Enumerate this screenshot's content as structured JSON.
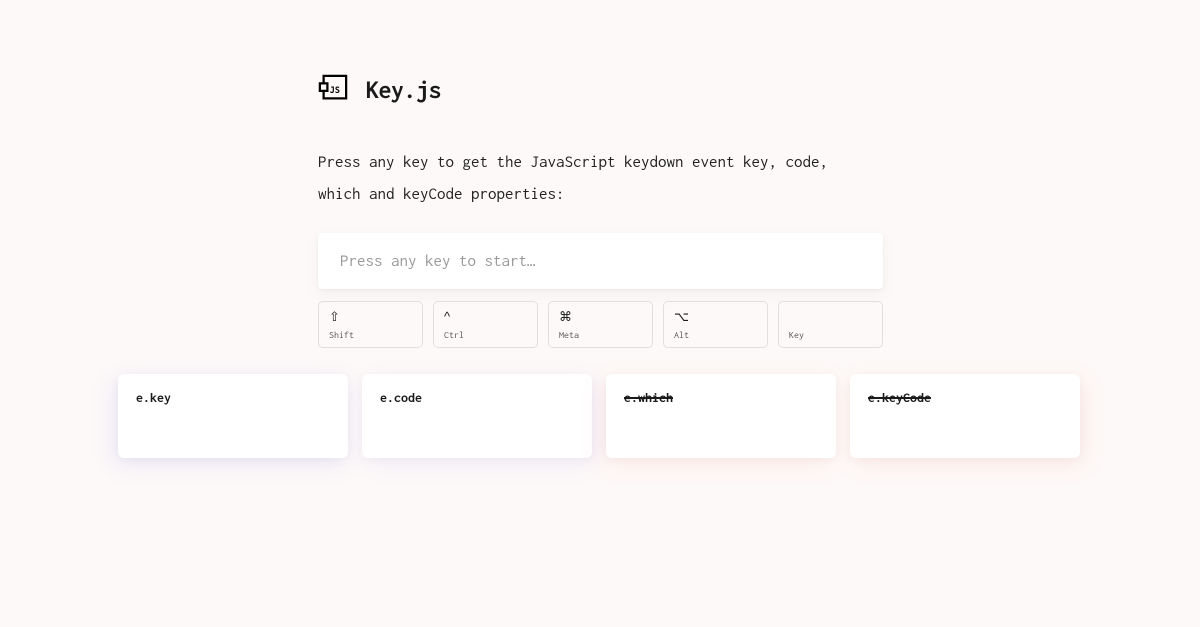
{
  "header": {
    "title": "Key.js"
  },
  "description": "Press any key to get the JavaScript keydown event key, code, which and keyCode properties:",
  "input": {
    "placeholder": "Press any key to start…"
  },
  "modifiers": [
    {
      "symbol": "⇧",
      "label": "Shift"
    },
    {
      "symbol": "^",
      "label": "Ctrl"
    },
    {
      "symbol": "⌘",
      "label": "Meta"
    },
    {
      "symbol": "⌥",
      "label": "Alt"
    },
    {
      "symbol": "",
      "label": "Key"
    }
  ],
  "cards": [
    {
      "label": "e.key",
      "deprecated": false
    },
    {
      "label": "e.code",
      "deprecated": false
    },
    {
      "label": "e.which",
      "deprecated": true
    },
    {
      "label": "e.keyCode",
      "deprecated": true
    }
  ]
}
